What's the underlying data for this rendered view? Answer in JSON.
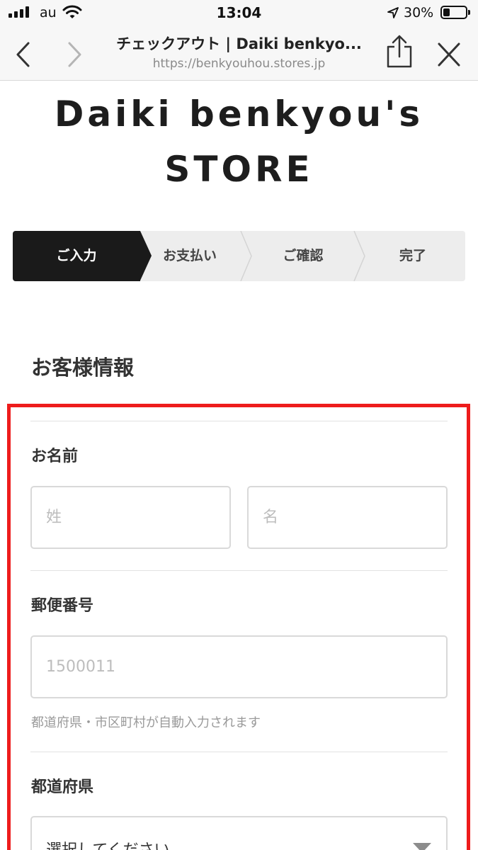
{
  "status_bar": {
    "carrier": "au",
    "time": "13:04",
    "battery_percent": "30%",
    "battery_level": 0.3
  },
  "browser": {
    "title": "チェックアウト | Daiki benkyo...",
    "url": "https://benkyouhou.stores.jp"
  },
  "store": {
    "title_line1": "Daiki benkyou's",
    "title_line2": "STORE"
  },
  "steps": [
    {
      "label": "ご入力",
      "active": true
    },
    {
      "label": "お支払い",
      "active": false
    },
    {
      "label": "ご確認",
      "active": false
    },
    {
      "label": "完了",
      "active": false
    }
  ],
  "customer_info": {
    "section_title": "お客様情報",
    "name": {
      "label": "お名前",
      "last_name_placeholder": "姓",
      "first_name_placeholder": "名"
    },
    "postal_code": {
      "label": "郵便番号",
      "placeholder": "1500011",
      "hint": "都道府県・市区町村が自動入力されます"
    },
    "prefecture": {
      "label": "都道府県",
      "selected": "選択してください"
    }
  },
  "colors": {
    "highlight_frame": "#ee1c1c",
    "active_step_bg": "#1a1a1a",
    "inactive_step_bg": "#ededed"
  }
}
